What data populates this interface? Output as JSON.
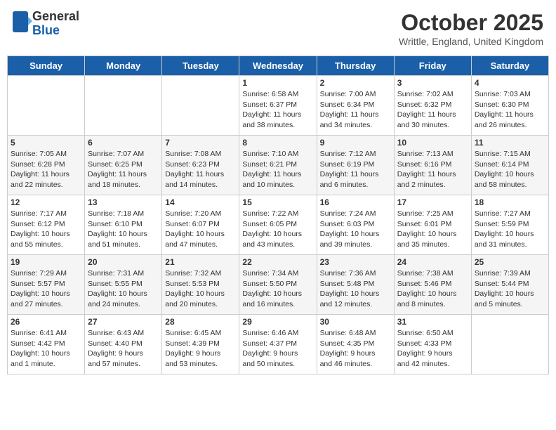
{
  "header": {
    "logo": {
      "general": "General",
      "blue": "Blue"
    },
    "title": "October 2025",
    "location": "Writtle, England, United Kingdom"
  },
  "calendar": {
    "days_of_week": [
      "Sunday",
      "Monday",
      "Tuesday",
      "Wednesday",
      "Thursday",
      "Friday",
      "Saturday"
    ],
    "weeks": [
      [
        {
          "day": "",
          "info": ""
        },
        {
          "day": "",
          "info": ""
        },
        {
          "day": "",
          "info": ""
        },
        {
          "day": "1",
          "info": "Sunrise: 6:58 AM\nSunset: 6:37 PM\nDaylight: 11 hours\nand 38 minutes."
        },
        {
          "day": "2",
          "info": "Sunrise: 7:00 AM\nSunset: 6:34 PM\nDaylight: 11 hours\nand 34 minutes."
        },
        {
          "day": "3",
          "info": "Sunrise: 7:02 AM\nSunset: 6:32 PM\nDaylight: 11 hours\nand 30 minutes."
        },
        {
          "day": "4",
          "info": "Sunrise: 7:03 AM\nSunset: 6:30 PM\nDaylight: 11 hours\nand 26 minutes."
        }
      ],
      [
        {
          "day": "5",
          "info": "Sunrise: 7:05 AM\nSunset: 6:28 PM\nDaylight: 11 hours\nand 22 minutes."
        },
        {
          "day": "6",
          "info": "Sunrise: 7:07 AM\nSunset: 6:25 PM\nDaylight: 11 hours\nand 18 minutes."
        },
        {
          "day": "7",
          "info": "Sunrise: 7:08 AM\nSunset: 6:23 PM\nDaylight: 11 hours\nand 14 minutes."
        },
        {
          "day": "8",
          "info": "Sunrise: 7:10 AM\nSunset: 6:21 PM\nDaylight: 11 hours\nand 10 minutes."
        },
        {
          "day": "9",
          "info": "Sunrise: 7:12 AM\nSunset: 6:19 PM\nDaylight: 11 hours\nand 6 minutes."
        },
        {
          "day": "10",
          "info": "Sunrise: 7:13 AM\nSunset: 6:16 PM\nDaylight: 11 hours\nand 2 minutes."
        },
        {
          "day": "11",
          "info": "Sunrise: 7:15 AM\nSunset: 6:14 PM\nDaylight: 10 hours\nand 58 minutes."
        }
      ],
      [
        {
          "day": "12",
          "info": "Sunrise: 7:17 AM\nSunset: 6:12 PM\nDaylight: 10 hours\nand 55 minutes."
        },
        {
          "day": "13",
          "info": "Sunrise: 7:18 AM\nSunset: 6:10 PM\nDaylight: 10 hours\nand 51 minutes."
        },
        {
          "day": "14",
          "info": "Sunrise: 7:20 AM\nSunset: 6:07 PM\nDaylight: 10 hours\nand 47 minutes."
        },
        {
          "day": "15",
          "info": "Sunrise: 7:22 AM\nSunset: 6:05 PM\nDaylight: 10 hours\nand 43 minutes."
        },
        {
          "day": "16",
          "info": "Sunrise: 7:24 AM\nSunset: 6:03 PM\nDaylight: 10 hours\nand 39 minutes."
        },
        {
          "day": "17",
          "info": "Sunrise: 7:25 AM\nSunset: 6:01 PM\nDaylight: 10 hours\nand 35 minutes."
        },
        {
          "day": "18",
          "info": "Sunrise: 7:27 AM\nSunset: 5:59 PM\nDaylight: 10 hours\nand 31 minutes."
        }
      ],
      [
        {
          "day": "19",
          "info": "Sunrise: 7:29 AM\nSunset: 5:57 PM\nDaylight: 10 hours\nand 27 minutes."
        },
        {
          "day": "20",
          "info": "Sunrise: 7:31 AM\nSunset: 5:55 PM\nDaylight: 10 hours\nand 24 minutes."
        },
        {
          "day": "21",
          "info": "Sunrise: 7:32 AM\nSunset: 5:53 PM\nDaylight: 10 hours\nand 20 minutes."
        },
        {
          "day": "22",
          "info": "Sunrise: 7:34 AM\nSunset: 5:50 PM\nDaylight: 10 hours\nand 16 minutes."
        },
        {
          "day": "23",
          "info": "Sunrise: 7:36 AM\nSunset: 5:48 PM\nDaylight: 10 hours\nand 12 minutes."
        },
        {
          "day": "24",
          "info": "Sunrise: 7:38 AM\nSunset: 5:46 PM\nDaylight: 10 hours\nand 8 minutes."
        },
        {
          "day": "25",
          "info": "Sunrise: 7:39 AM\nSunset: 5:44 PM\nDaylight: 10 hours\nand 5 minutes."
        }
      ],
      [
        {
          "day": "26",
          "info": "Sunrise: 6:41 AM\nSunset: 4:42 PM\nDaylight: 10 hours\nand 1 minute."
        },
        {
          "day": "27",
          "info": "Sunrise: 6:43 AM\nSunset: 4:40 PM\nDaylight: 9 hours\nand 57 minutes."
        },
        {
          "day": "28",
          "info": "Sunrise: 6:45 AM\nSunset: 4:39 PM\nDaylight: 9 hours\nand 53 minutes."
        },
        {
          "day": "29",
          "info": "Sunrise: 6:46 AM\nSunset: 4:37 PM\nDaylight: 9 hours\nand 50 minutes."
        },
        {
          "day": "30",
          "info": "Sunrise: 6:48 AM\nSunset: 4:35 PM\nDaylight: 9 hours\nand 46 minutes."
        },
        {
          "day": "31",
          "info": "Sunrise: 6:50 AM\nSunset: 4:33 PM\nDaylight: 9 hours\nand 42 minutes."
        },
        {
          "day": "",
          "info": ""
        }
      ]
    ]
  }
}
